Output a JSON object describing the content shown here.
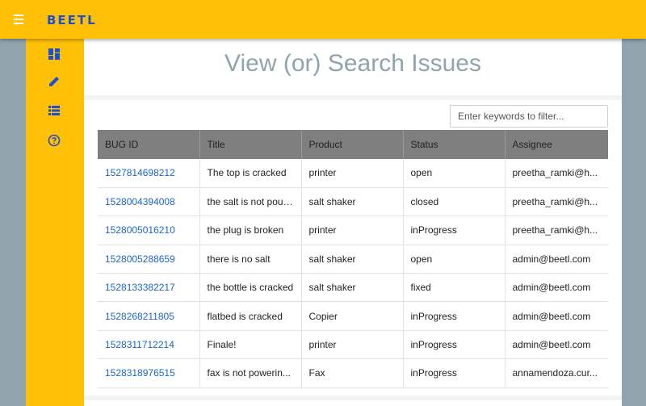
{
  "app": {
    "logo": "BEETL"
  },
  "page": {
    "title": "View (or) Search Issues"
  },
  "search": {
    "placeholder": "Enter keywords to filter..."
  },
  "sidebar": {
    "items": [
      {
        "icon": "dashboard-icon"
      },
      {
        "icon": "pencil-icon"
      },
      {
        "icon": "list-icon"
      },
      {
        "icon": "help-icon"
      }
    ]
  },
  "colors": {
    "accent": "#ffc107",
    "logo": "#1e4fd1",
    "link": "#1e64c8",
    "header": "#7f7f7f",
    "background": "#90a4ae"
  },
  "table": {
    "headers": [
      "BUG ID",
      "Title",
      "Product",
      "Status",
      "Assignee"
    ],
    "rows": [
      [
        "1527814698212",
        "The top is cracked",
        "printer",
        "open",
        "preetha_ramki@h..."
      ],
      [
        "1528004394008",
        "the salt is not pour...",
        "salt shaker",
        "closed",
        "preetha_ramki@h..."
      ],
      [
        "1528005016210",
        "the plug is broken",
        "printer",
        "inProgress",
        "preetha_ramki@h..."
      ],
      [
        "1528005288659",
        "there is no salt",
        "salt shaker",
        "open",
        "admin@beetl.com"
      ],
      [
        "1528133382217",
        "the bottle is cracked",
        "salt shaker",
        "fixed",
        "admin@beetl.com"
      ],
      [
        "1528268211805",
        "flatbed is cracked",
        "Copier",
        "inProgress",
        "admin@beetl.com"
      ],
      [
        "1528311712214",
        "Finale!",
        "printer",
        "inProgress",
        "admin@beetl.com"
      ],
      [
        "1528318976515",
        "fax is not powerin...",
        "Fax",
        "inProgress",
        "annamendoza.cur..."
      ]
    ]
  }
}
